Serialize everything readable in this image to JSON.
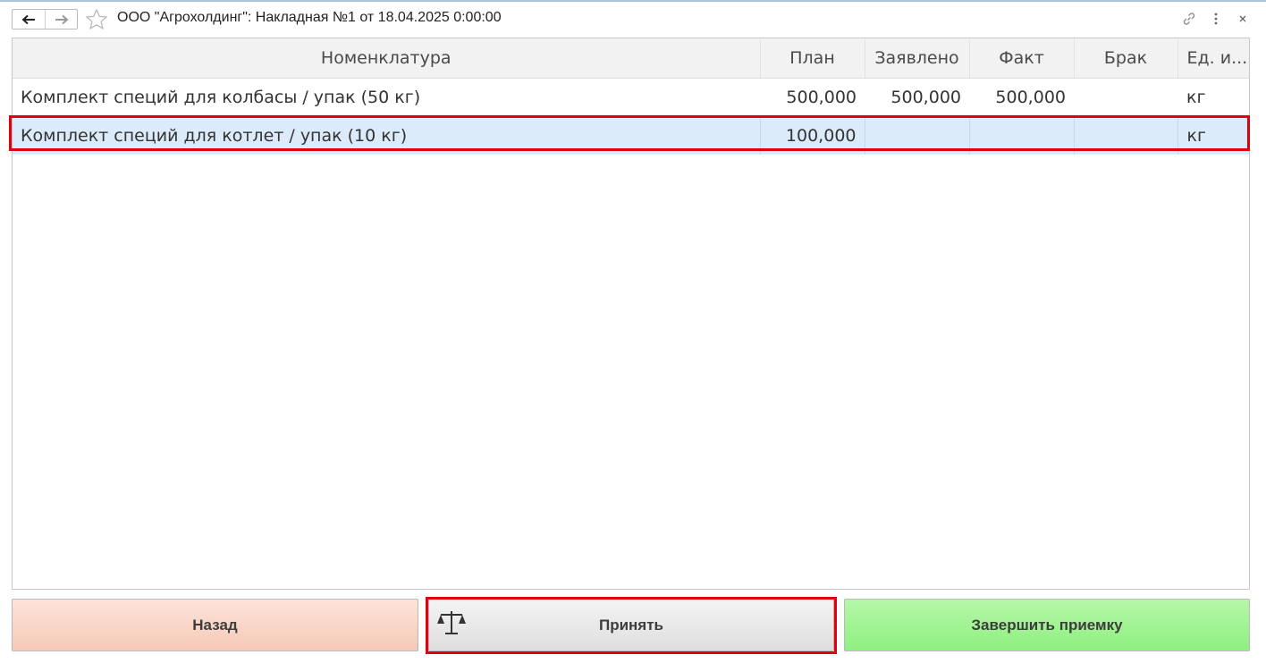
{
  "window": {
    "title": "ООО \"Агрохолдинг\": Накладная №1 от 18.04.2025 0:00:00",
    "icons": [
      "back-arrow-icon",
      "forward-arrow-icon",
      "star-icon",
      "link-icon",
      "more-icon",
      "close-icon"
    ]
  },
  "table": {
    "columns": [
      "Номенклатура",
      "План",
      "Заявлено",
      "Факт",
      "Брак",
      "Ед. и..."
    ],
    "rows": [
      {
        "name": "Комплект специй для колбасы / упак (50 кг)",
        "plan": "500,000",
        "declared": "500,000",
        "fact": "500,000",
        "defect": "",
        "unit": "кг"
      },
      {
        "name": "Комплект специй для котлет / упак (10 кг)",
        "plan": "100,000",
        "declared": "",
        "fact": "",
        "defect": "",
        "unit": "кг",
        "selected": true
      }
    ]
  },
  "buttons": {
    "back": "Назад",
    "accept": "Принять",
    "finish": "Завершить приемку"
  },
  "colors": {
    "back_button": "#f6c9b8",
    "accept_button": "#dedede",
    "finish_button": "#8ef07f",
    "selected_row": "#dcebf9",
    "highlight": "#e0000f"
  }
}
